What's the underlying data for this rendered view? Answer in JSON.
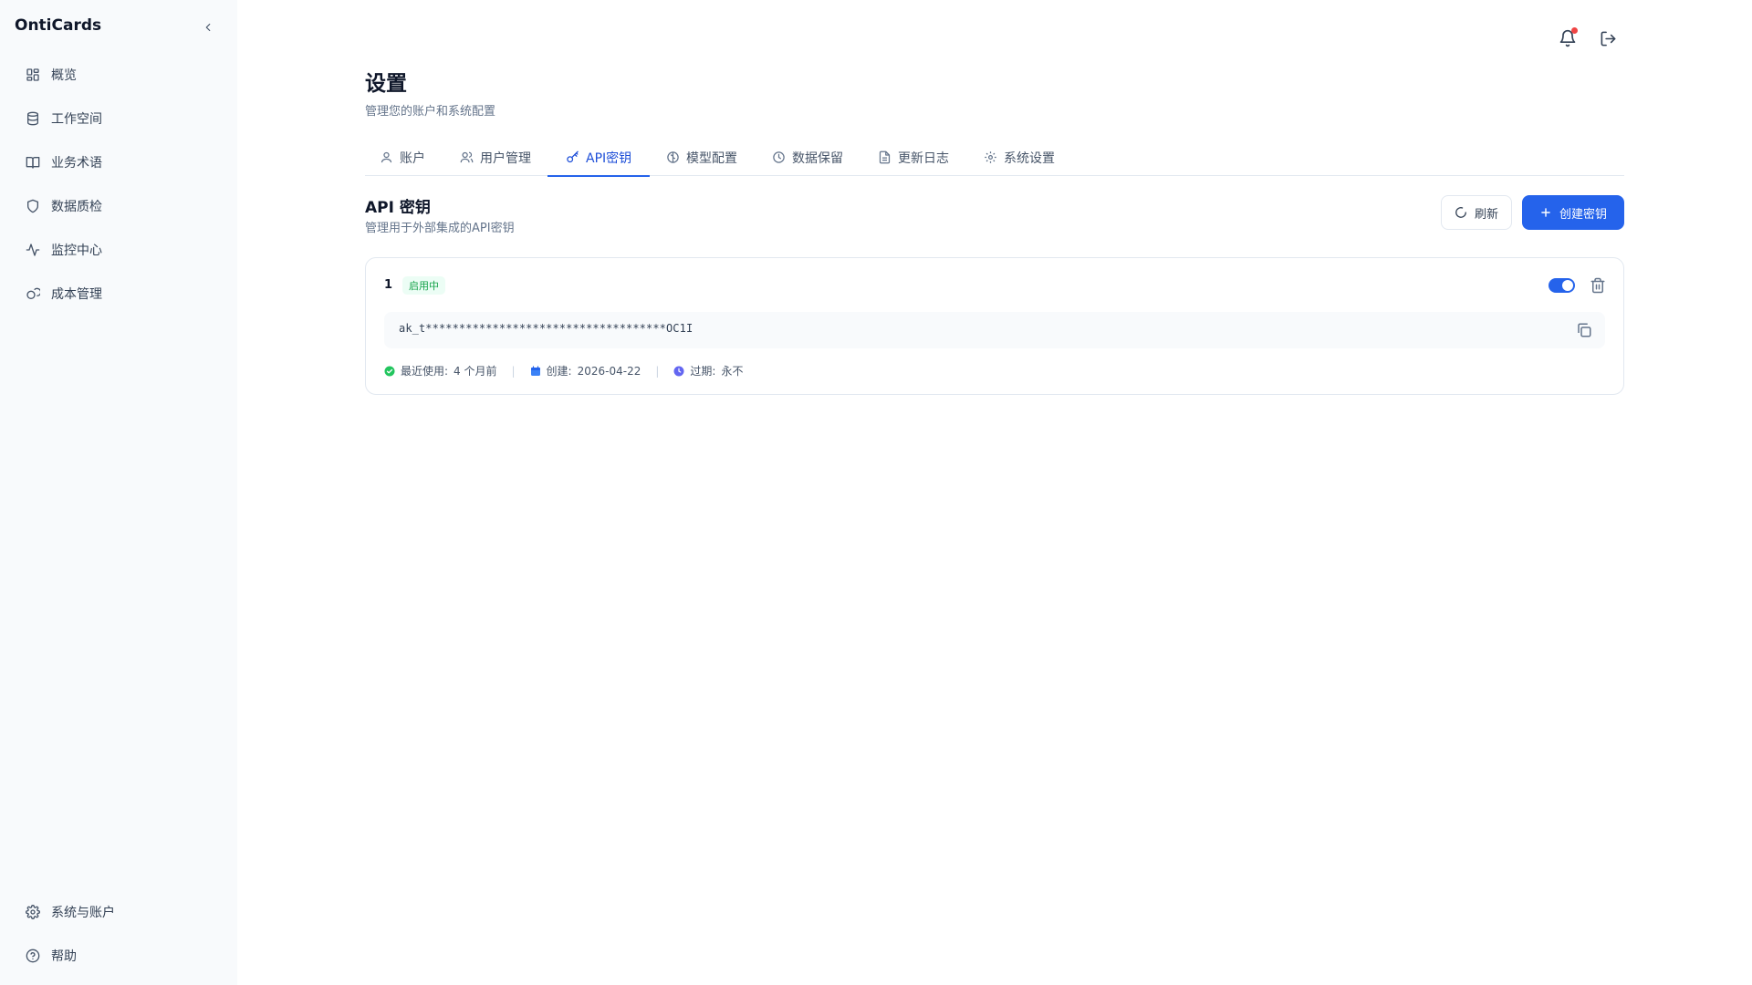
{
  "sidebar": {
    "brand": "OntiCards",
    "items": [
      {
        "label": "概览",
        "icon": "grid-icon"
      },
      {
        "label": "工作空间",
        "icon": "database-icon"
      },
      {
        "label": "业务术语",
        "icon": "book-icon"
      },
      {
        "label": "数据质检",
        "icon": "shield-icon"
      },
      {
        "label": "监控中心",
        "icon": "activity-icon"
      },
      {
        "label": "成本管理",
        "icon": "coins-icon"
      }
    ],
    "bottom_items": [
      {
        "label": "系统与账户",
        "icon": "gear-icon"
      },
      {
        "label": "帮助",
        "icon": "help-circle-icon"
      }
    ]
  },
  "header": {
    "notification_icon": "bell-icon",
    "logout_icon": "log-out-icon",
    "notification_dot_color": "#ef4444"
  },
  "page": {
    "title": "设置",
    "subtitle": "管理您的账户和系统配置"
  },
  "tabs": [
    {
      "label": "账户",
      "icon": "user-icon",
      "active": false
    },
    {
      "label": "用户管理",
      "icon": "users-icon",
      "active": false
    },
    {
      "label": "API密钥",
      "icon": "key-icon",
      "active": true
    },
    {
      "label": "模型配置",
      "icon": "brain-icon",
      "active": false
    },
    {
      "label": "数据保留",
      "icon": "clock-icon",
      "active": false
    },
    {
      "label": "更新日志",
      "icon": "file-text-icon",
      "active": false
    },
    {
      "label": "系统设置",
      "icon": "gear-icon",
      "active": false
    }
  ],
  "api_keys": {
    "title": "API 密钥",
    "subtitle": "管理用于外部集成的API密钥",
    "refresh_label": "刷新",
    "create_label": "创建密钥",
    "accent_color": "#2563eb",
    "keys": [
      {
        "name": "1",
        "status": "启用中",
        "enabled": true,
        "masked_key": "ak_t************************************OC1I",
        "last_used_label": "最近使用:",
        "last_used_value": "4 个月前",
        "created_label": "创建:",
        "created_value": "2026-04-22",
        "expires_label": "过期:",
        "expires_value": "永不"
      }
    ]
  }
}
